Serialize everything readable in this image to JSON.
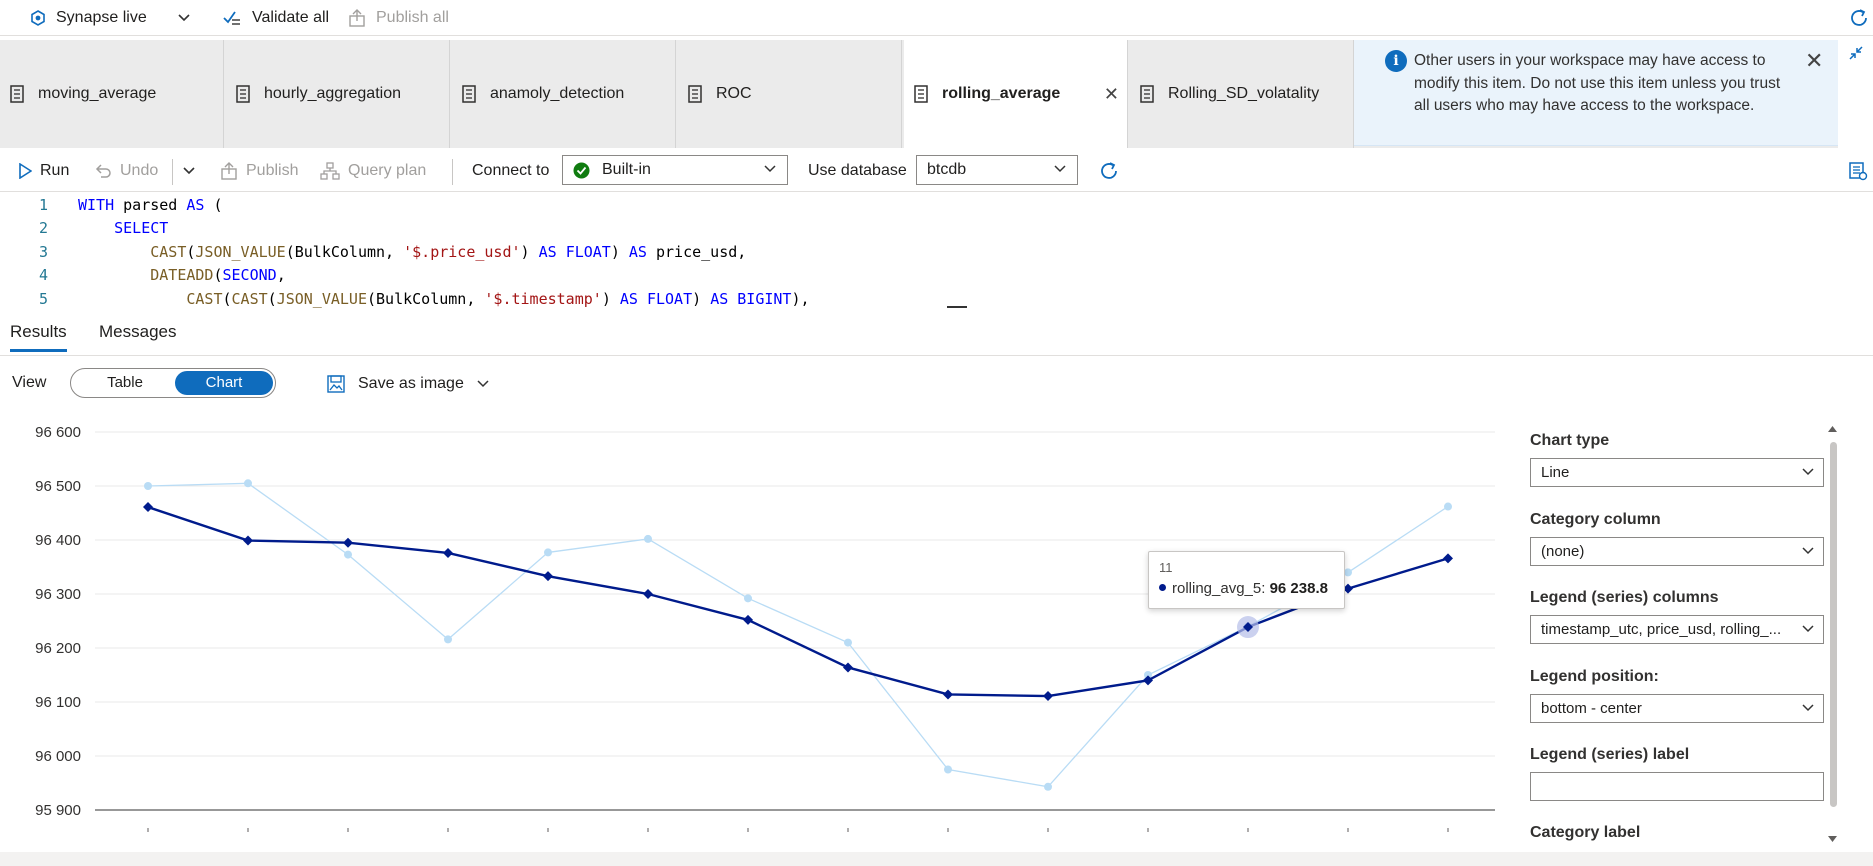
{
  "topbar": {
    "env_label": "Synapse live",
    "validate_label": "Validate all",
    "publish_all_label": "Publish all"
  },
  "tabs": [
    {
      "label": "moving_average"
    },
    {
      "label": "hourly_aggregation"
    },
    {
      "label": "anamoly_detection"
    },
    {
      "label": "ROC"
    },
    {
      "label": "rolling_average",
      "active": true
    },
    {
      "label": "Rolling_SD_volatality"
    }
  ],
  "banner": {
    "message": "Other users in your workspace may have access to modify this item. Do not use this item unless you trust all users who may have access to the workspace."
  },
  "toolbar": {
    "run_label": "Run",
    "undo_label": "Undo",
    "publish_label": "Publish",
    "query_plan_label": "Query plan",
    "connect_to_label": "Connect to",
    "connect_to_value": "Built-in",
    "use_database_label": "Use database",
    "database_value": "btcdb"
  },
  "editor": {
    "lines": [
      {
        "n": "1",
        "text": "WITH parsed AS ("
      },
      {
        "n": "2",
        "text": "    SELECT"
      },
      {
        "n": "3",
        "text": "        CAST(JSON_VALUE(BulkColumn, '$.price_usd') AS FLOAT) AS price_usd,"
      },
      {
        "n": "4",
        "text": "        DATEADD(SECOND,"
      },
      {
        "n": "5",
        "text": "            CAST(CAST(JSON_VALUE(BulkColumn, '$.timestamp') AS FLOAT) AS BIGINT),"
      }
    ]
  },
  "results": {
    "tab_results": "Results",
    "tab_messages": "Messages",
    "view_label": "View",
    "view_table": "Table",
    "view_chart": "Chart",
    "save_image_label": "Save as image"
  },
  "panel": {
    "chart_type_label": "Chart type",
    "chart_type_value": "Line",
    "category_column_label": "Category column",
    "category_column_value": "(none)",
    "legend_columns_label": "Legend (series) columns",
    "legend_columns_value": "timestamp_utc, price_usd, rolling_...",
    "legend_position_label": "Legend position:",
    "legend_position_value": "bottom - center",
    "legend_label_label": "Legend (series) label",
    "legend_label_value": "",
    "category_label_label": "Category label"
  },
  "tooltip": {
    "index": "11",
    "series": "rolling_avg_5:",
    "value": "96 238.8"
  },
  "colors": {
    "accent": "#0f6cbd",
    "rolling_series": "#001b8c",
    "price_series": "#b9dcf5",
    "success": "#107c10"
  },
  "chart_data": {
    "type": "line",
    "x": [
      0,
      1,
      2,
      3,
      4,
      5,
      6,
      7,
      8,
      9,
      10,
      11,
      12,
      13
    ],
    "series": [
      {
        "name": "price_usd",
        "values": [
          96500,
          96505,
          96373,
          96216,
          96377,
          96402,
          96292,
          96210,
          95975,
          95943,
          96150,
          96240,
          96340,
          96462
        ]
      },
      {
        "name": "rolling_avg_5",
        "values": [
          96461,
          96399,
          96395,
          96376,
          96333,
          96300,
          96252,
          96164,
          96114,
          96111,
          96140,
          96238.8,
          96310,
          96366
        ]
      }
    ],
    "yticks": [
      "96 600",
      "96 500",
      "96 400",
      "96 300",
      "96 200",
      "96 100",
      "96 000",
      "95 900"
    ],
    "ylim": [
      95900,
      96600
    ],
    "grid": true,
    "highlight_index": 11
  }
}
